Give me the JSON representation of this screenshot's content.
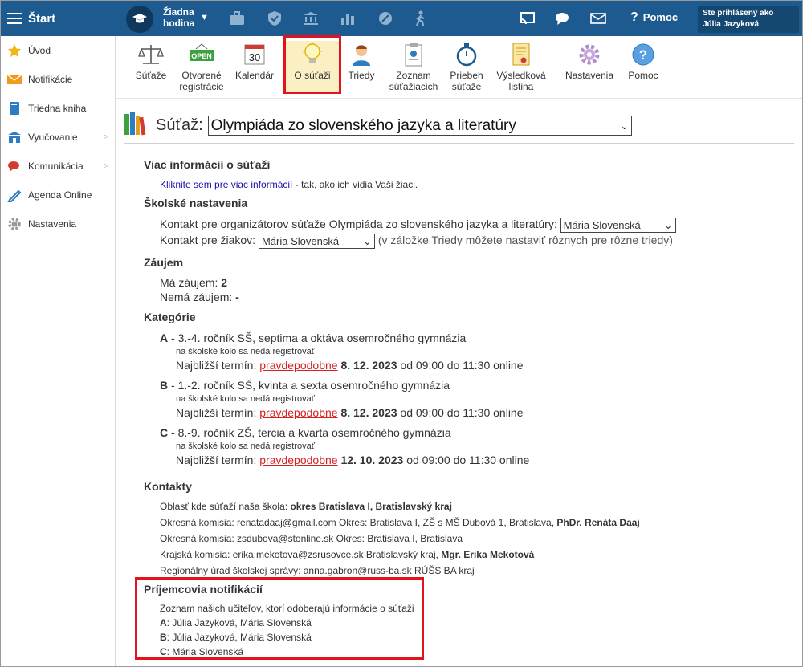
{
  "header": {
    "brand": "Štart",
    "hour_line1": "Žiadna",
    "hour_line2": "hodina",
    "help": "Pomoc",
    "user_line1": "Ste prihlásený ako",
    "user_line2": "Júlia Jazyková"
  },
  "sidebar": {
    "items": [
      {
        "label": "Úvod",
        "icon": "star-icon"
      },
      {
        "label": "Notifikácie",
        "icon": "envelope-icon"
      },
      {
        "label": "Triedna kniha",
        "icon": "book-icon"
      },
      {
        "label": "Vyučovanie",
        "icon": "school-icon"
      },
      {
        "label": "Komunikácia",
        "icon": "chat-icon"
      },
      {
        "label": "Agenda Online",
        "icon": "pen-icon"
      },
      {
        "label": "Nastavenia",
        "icon": "gear-icon"
      }
    ]
  },
  "toolbar": {
    "tools": [
      {
        "l1": "Súťaže",
        "l2": ""
      },
      {
        "l1": "Otvorené",
        "l2": "registrácie"
      },
      {
        "l1": "Kalendár",
        "l2": ""
      },
      {
        "l1": "O súťaži",
        "l2": ""
      },
      {
        "l1": "Triedy",
        "l2": ""
      },
      {
        "l1": "Zoznam",
        "l2": "súťažiacich"
      },
      {
        "l1": "Priebeh",
        "l2": "súťaže"
      },
      {
        "l1": "Výsledková",
        "l2": "listina"
      },
      {
        "l1": "Nastavenia",
        "l2": ""
      },
      {
        "l1": "Pomoc",
        "l2": ""
      }
    ],
    "calendar_day": "30",
    "open_sign": "OPEN"
  },
  "contest": {
    "label": "Súťaž:",
    "selected": "Olympiáda zo slovenského jazyka a literatúry"
  },
  "info": {
    "heading": "Viac informácií o súťaži",
    "link": "Kliknite sem pre viac informácií",
    "link_suffix": " - tak, ako ich vidia Vaši žiaci."
  },
  "school": {
    "heading": "Školské nastavenia",
    "organizer_label": "Kontakt pre organizátorov súťaže Olympiáda zo slovenského jazyka a literatúry:",
    "organizer_value": "Mária Slovenská",
    "students_label": "Kontakt pre žiakov:",
    "students_value": "Mária Slovenská",
    "students_note": "(v záložke Triedy môžete nastaviť rôznych pre rôzne triedy)"
  },
  "interest": {
    "heading": "Záujem",
    "yes_label": "Má záujem:",
    "yes_value": "2",
    "no_label": "Nemá záujem:",
    "no_value": "-"
  },
  "categories": {
    "heading": "Kategórie",
    "items": [
      {
        "code": "A",
        "desc": " - 3.-4. ročník SŠ, septima a oktáva osemročného gymnázia",
        "note": "na školské kolo sa nedá registrovať",
        "term_label": "Najbližší termín:",
        "probably": "pravdepodobne",
        "date": "8. 12. 2023",
        "time": "od 09:00 do 11:30 online"
      },
      {
        "code": "B",
        "desc": " - 1.-2. ročník SŠ, kvinta a sexta osemročného gymnázia",
        "note": "na školské kolo sa nedá registrovať",
        "term_label": "Najbližší termín:",
        "probably": "pravdepodobne",
        "date": "8. 12. 2023",
        "time": "od 09:00 do 11:30 online"
      },
      {
        "code": "C",
        "desc": " - 8.-9. ročník ZŠ, tercia a kvarta osemročného gymnázia",
        "note": "na školské kolo sa nedá registrovať",
        "term_label": "Najbližší termín:",
        "probably": "pravdepodobne",
        "date": "12. 10. 2023",
        "time": "od 09:00 do 11:30 online"
      }
    ]
  },
  "contacts": {
    "heading": "Kontakty",
    "area_label": "Oblasť kde súťaží naša škola:",
    "area_value": "okres Bratislava I, Bratislavský kraj",
    "rows": [
      {
        "text": "Okresná komisia: renatadaaj@gmail.com Okres: Bratislava I, ZŠ s MŠ Dubová 1, Bratislava,",
        "bold": "PhDr. Renáta Daaj"
      },
      {
        "text": "Okresná komisia: zsdubova@stonline.sk Okres: Bratislava I, Bratislava",
        "bold": ""
      },
      {
        "text": "Krajská komisia: erika.mekotova@zsrusovce.sk Bratislavský kraj,",
        "bold": "Mgr. Erika Mekotová"
      },
      {
        "text": "Regionálny úrad školskej správy: anna.gabron@russ-ba.sk RÚŠS BA kraj",
        "bold": ""
      }
    ]
  },
  "notifications": {
    "heading": "Príjemcovia notifikácií",
    "intro": "Zoznam našich učiteľov, ktorí odoberajú informácie o súťaži",
    "rows": [
      {
        "code": "A",
        "names": ": Júlia Jazyková, Mária Slovenská"
      },
      {
        "code": "B",
        "names": ": Júlia Jazyková, Mária Slovenská"
      },
      {
        "code": "C",
        "names": ": Mária Slovenská"
      }
    ]
  },
  "colors": {
    "header_bg": "#1d5a8f",
    "highlight_red": "#e2131d",
    "active_tab_bg": "#fbf0c4"
  }
}
